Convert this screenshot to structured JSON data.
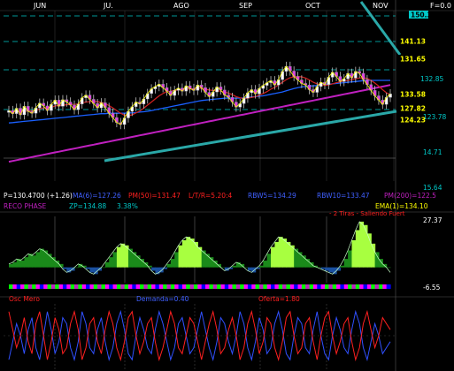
{
  "header": {
    "months": [
      "JUN",
      "JU.",
      "AGO",
      "SEP",
      "OCT",
      "NOV"
    ],
    "corner_label": "F=0.0"
  },
  "price_panel": {
    "right_axis": [
      "150.38",
      "141.13",
      "131.65",
      "132.85",
      "133.58",
      "127.82",
      "124.23",
      "123.78",
      "14.71",
      "15.64"
    ],
    "price_tags": [
      {
        "text": "150.38",
        "bg": "#00c8c8",
        "fg": "#000"
      },
      {
        "text": "141.13",
        "bg": "#000",
        "fg": "#ffff00"
      },
      {
        "text": "131.65",
        "bg": "#000",
        "fg": "#ffff00"
      },
      {
        "text": "133.58",
        "bg": "#000",
        "fg": "#ffff00"
      },
      {
        "text": "127.82",
        "bg": "#000",
        "fg": "#ffff00"
      },
      {
        "text": "124.23",
        "bg": "#000",
        "fg": "#ffff00"
      }
    ],
    "info_row1": [
      {
        "text": "P=130.4700 (+1.26)",
        "color": "#ffffff"
      },
      {
        "text": "MA(6)=127.26",
        "color": "#4060ff"
      },
      {
        "text": "PM(50)=131.47",
        "color": "#ff2020"
      },
      {
        "text": "L/T/R=5.20:4",
        "color": "#ff2020"
      },
      {
        "text": "RBW5=134.29",
        "color": "#4060ff"
      },
      {
        "text": "RBW10=133.47",
        "color": "#4060ff"
      },
      {
        "text": "PM(200)=122.5",
        "color": "#c020c0"
      }
    ],
    "info_row2": [
      {
        "text": "RECO PHASE",
        "color": "#c020c0"
      },
      {
        "text": "ZP=134.88",
        "color": "#00c8c8"
      },
      {
        "text": "3.38%",
        "color": "#00c8c8"
      },
      {
        "text": "EMA(1)=134.10",
        "color": "#ffff00"
      }
    ]
  },
  "oscillator_panel": {
    "title": "- 2 Tiras - Saliendo Fuert",
    "scale": [
      "27.37",
      "-6.55"
    ]
  },
  "bottom_panel": {
    "labels": [
      {
        "text": "Osc Mero",
        "color": "#ff2020"
      },
      {
        "text": "Demanda=0.40",
        "color": "#4060ff"
      },
      {
        "text": "Oferta=1.80",
        "color": "#ff2020"
      }
    ]
  },
  "chart_data": {
    "type": "line",
    "title": "",
    "months": [
      "JUN",
      "JU.",
      "AGO",
      "SEP",
      "OCT",
      "NOV"
    ],
    "close": [
      126.2,
      125.4,
      126.8,
      125.1,
      127.3,
      126.0,
      125.5,
      126.9,
      128.1,
      127.4,
      126.2,
      127.8,
      128.9,
      127.3,
      129.0,
      128.4,
      127.6,
      126.4,
      127.9,
      129.5,
      130.2,
      129.1,
      128.0,
      126.9,
      128.2,
      127.0,
      125.5,
      124.4,
      123.1,
      122.6,
      124.3,
      126.0,
      127.2,
      128.4,
      127.9,
      129.2,
      130.6,
      131.8,
      132.4,
      133.0,
      132.1,
      131.2,
      130.1,
      131.4,
      132.0,
      131.2,
      132.6,
      131.9,
      131.4,
      132.8,
      132.1,
      130.9,
      129.8,
      131.0,
      132.3,
      131.5,
      130.2,
      129.6,
      128.4,
      127.1,
      128.0,
      129.4,
      130.8,
      131.6,
      130.5,
      131.9,
      132.7,
      133.4,
      133.9,
      132.8,
      134.2,
      136.3,
      137.6,
      136.4,
      135.0,
      134.1,
      133.2,
      132.8,
      131.6,
      130.9,
      132.4,
      133.5,
      132.9,
      134.8,
      136.1,
      135.0,
      133.7,
      134.4,
      135.8,
      134.6,
      136.3,
      135.8,
      134.2,
      132.9,
      131.4,
      130.0,
      128.9,
      127.8,
      129.6,
      130.5
    ],
    "ma6": [
      126.0,
      125.9,
      126.0,
      125.9,
      126.0,
      126.1,
      126.1,
      126.2,
      126.6,
      126.9,
      126.9,
      127.0,
      127.4,
      127.5,
      127.6,
      127.7,
      127.8,
      127.8,
      127.9,
      128.2,
      128.4,
      128.5,
      128.6,
      128.5,
      128.3,
      128.0,
      127.5,
      126.9,
      126.2,
      125.5,
      125.0,
      124.9,
      125.1,
      125.6,
      126.1,
      126.8,
      127.6,
      128.4,
      129.2,
      130.0,
      130.6,
      131.1,
      131.2,
      131.4,
      131.5,
      131.6,
      131.7,
      131.8,
      131.9,
      132.0,
      131.9,
      131.7,
      131.5,
      131.4,
      131.3,
      131.2,
      131.0,
      130.7,
      130.3,
      129.8,
      129.5,
      129.3,
      129.4,
      129.6,
      129.8,
      130.2,
      130.6,
      131.1,
      131.7,
      132.2,
      132.8,
      133.5,
      134.2,
      134.7,
      134.9,
      135.0,
      134.9,
      134.6,
      134.1,
      133.5,
      133.1,
      132.9,
      132.7,
      132.8,
      133.1,
      133.4,
      133.6,
      133.8,
      134.0,
      134.2,
      134.4,
      134.6,
      134.7,
      134.5,
      134.0,
      133.3,
      132.5,
      131.6,
      130.8,
      130.3
    ],
    "ema_long": [
      123.0,
      123.1,
      123.2,
      123.3,
      123.4,
      123.5,
      123.6,
      123.7,
      123.8,
      123.9,
      124.0,
      124.1,
      124.2,
      124.3,
      124.4,
      124.5,
      124.6,
      124.7,
      124.8,
      124.9,
      125.0,
      125.1,
      125.2,
      125.3,
      125.4,
      125.4,
      125.5,
      125.5,
      125.5,
      125.5,
      125.5,
      125.6,
      125.6,
      125.7,
      125.8,
      125.9,
      126.0,
      126.2,
      126.4,
      126.6,
      126.8,
      127.0,
      127.2,
      127.4,
      127.6,
      127.8,
      128.0,
      128.2,
      128.4,
      128.6,
      128.8,
      128.9,
      129.0,
      129.1,
      129.2,
      129.3,
      129.4,
      129.4,
      129.4,
      129.4,
      129.4,
      129.5,
      129.6,
      129.7,
      129.8,
      129.9,
      130.0,
      130.2,
      130.4,
      130.6,
      130.8,
      131.0,
      131.3,
      131.6,
      131.9,
      132.1,
      132.3,
      132.4,
      132.5,
      132.6,
      132.7,
      132.8,
      132.9,
      133.0,
      133.1,
      133.2,
      133.3,
      133.4,
      133.5,
      133.6,
      133.7,
      133.8,
      133.9,
      134.0,
      134.0,
      134.0,
      134.0,
      134.0,
      134.0,
      134.0
    ],
    "pm200": [
      113.0,
      113.2,
      113.4,
      113.6,
      113.8,
      114.0,
      114.2,
      114.4,
      114.6,
      114.8,
      115.0,
      115.2,
      115.4,
      115.6,
      115.8,
      116.0,
      116.2,
      116.4,
      116.6,
      116.8,
      117.0,
      117.2,
      117.4,
      117.6,
      117.8,
      118.0,
      118.2,
      118.4,
      118.6,
      118.8,
      119.0,
      119.2,
      119.4,
      119.6,
      119.8,
      120.0,
      120.2,
      120.4,
      120.6,
      120.8,
      121.0,
      121.2,
      121.4,
      121.6,
      121.8,
      122.0,
      122.2,
      122.4,
      122.6,
      122.8,
      123.0,
      123.2,
      123.4,
      123.6,
      123.8,
      124.0,
      124.2,
      124.4,
      124.6,
      124.8,
      125.0,
      125.2,
      125.4,
      125.6,
      125.8,
      126.0,
      126.2,
      126.4,
      126.6,
      126.8,
      127.0,
      127.2,
      127.4,
      127.6,
      127.8,
      128.0,
      128.2,
      128.4,
      128.6,
      128.8,
      129.0,
      129.2,
      129.4,
      129.6,
      129.8,
      130.0,
      130.2,
      130.4,
      130.6,
      130.8,
      131.0,
      131.2,
      131.4,
      131.6,
      131.8,
      132.0,
      132.2,
      132.4,
      132.6,
      132.8
    ],
    "oscillator": [
      2,
      3,
      5,
      4,
      6,
      8,
      7,
      9,
      11,
      10,
      8,
      6,
      4,
      2,
      -1,
      -3,
      -2,
      0,
      2,
      1,
      -1,
      -3,
      -4,
      -2,
      0,
      3,
      6,
      9,
      12,
      14,
      13,
      11,
      9,
      7,
      5,
      3,
      1,
      -2,
      -4,
      -3,
      -1,
      2,
      5,
      9,
      13,
      16,
      18,
      17,
      15,
      12,
      10,
      8,
      6,
      4,
      2,
      0,
      -2,
      -1,
      1,
      3,
      2,
      0,
      -2,
      -3,
      -1,
      1,
      4,
      8,
      12,
      15,
      18,
      17,
      15,
      13,
      11,
      9,
      7,
      5,
      3,
      1,
      0,
      -1,
      -2,
      -3,
      -4,
      -2,
      1,
      5,
      10,
      16,
      22,
      27,
      25,
      20,
      14,
      9,
      5,
      2,
      0,
      -3
    ],
    "demanda": [
      0.1,
      0.4,
      0.7,
      0.5,
      0.2,
      0.6,
      0.8,
      0.3,
      0.1,
      0.5,
      0.9,
      0.6,
      0.2,
      0.4,
      0.8,
      0.7,
      0.3,
      0.1,
      0.4,
      0.9,
      0.7,
      0.3,
      0.2,
      0.6,
      0.8,
      0.4,
      0.1,
      0.3,
      0.7,
      0.9,
      0.6,
      0.2,
      0.1,
      0.5,
      0.8,
      0.6,
      0.3,
      0.2,
      0.6,
      0.9,
      0.7,
      0.4,
      0.1,
      0.3,
      0.7,
      0.8,
      0.5,
      0.2,
      0.3,
      0.6,
      0.9,
      0.6,
      0.3,
      0.1,
      0.4,
      0.8,
      0.7,
      0.4,
      0.2,
      0.5,
      0.9,
      0.7,
      0.3,
      0.1,
      0.4,
      0.8,
      0.6,
      0.2,
      0.3,
      0.7,
      0.9,
      0.6,
      0.2,
      0.1,
      0.5,
      0.8,
      0.7,
      0.3,
      0.2,
      0.6,
      0.9,
      0.5,
      0.2,
      0.1,
      0.5,
      0.8,
      0.6,
      0.3,
      0.2,
      0.6,
      0.9,
      0.7,
      0.3,
      0.1,
      0.4,
      0.7,
      0.5,
      0.2,
      0.3,
      0.4
    ],
    "oferta": [
      0.9,
      0.6,
      0.3,
      0.5,
      0.8,
      0.4,
      0.2,
      0.7,
      0.9,
      0.5,
      0.1,
      0.4,
      0.8,
      0.6,
      0.2,
      0.3,
      0.7,
      0.9,
      0.6,
      0.1,
      0.3,
      0.7,
      0.8,
      0.4,
      0.2,
      0.6,
      0.9,
      0.7,
      0.3,
      0.1,
      0.4,
      0.8,
      0.9,
      0.5,
      0.2,
      0.4,
      0.7,
      0.8,
      0.4,
      0.1,
      0.3,
      0.6,
      0.9,
      0.7,
      0.3,
      0.2,
      0.5,
      0.8,
      0.7,
      0.4,
      0.1,
      0.4,
      0.7,
      0.9,
      0.6,
      0.2,
      0.3,
      0.6,
      0.8,
      0.5,
      0.1,
      0.3,
      0.7,
      0.9,
      0.6,
      0.2,
      0.4,
      0.8,
      0.7,
      0.3,
      0.1,
      0.4,
      0.8,
      0.9,
      0.5,
      0.2,
      0.3,
      0.7,
      0.8,
      0.4,
      0.1,
      0.5,
      0.8,
      0.9,
      0.5,
      0.2,
      0.4,
      0.7,
      0.8,
      0.4,
      0.1,
      0.3,
      0.7,
      0.9,
      0.6,
      0.3,
      0.5,
      0.8,
      0.7,
      0.6
    ]
  }
}
